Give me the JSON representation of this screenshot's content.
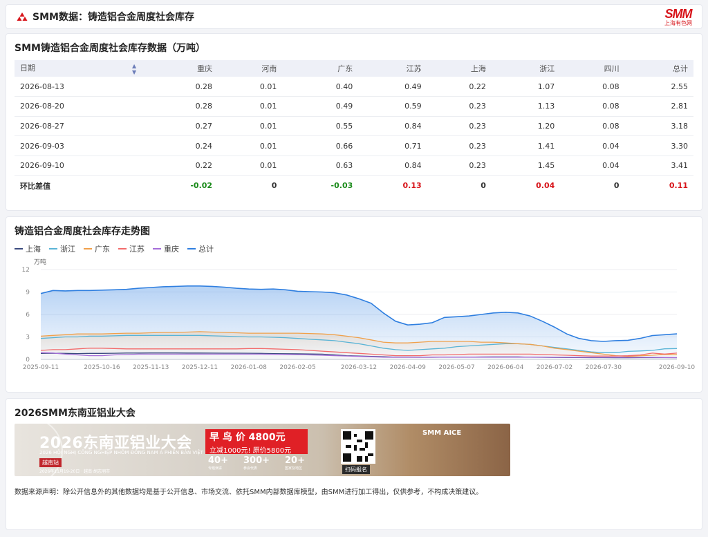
{
  "header": {
    "title": "SMM数据：铸造铝合金周度社会库存",
    "brand_main": "SMM",
    "brand_sub": "上海有色网"
  },
  "table": {
    "title": "SMM铸造铝合金周度社会库存数据（万吨）",
    "columns": [
      "日期",
      "重庆",
      "河南",
      "广东",
      "江苏",
      "上海",
      "浙江",
      "四川",
      "总计"
    ],
    "rows": [
      [
        "2026-08-13",
        "0.28",
        "0.01",
        "0.40",
        "0.49",
        "0.22",
        "1.07",
        "0.08",
        "2.55"
      ],
      [
        "2026-08-20",
        "0.28",
        "0.01",
        "0.49",
        "0.59",
        "0.23",
        "1.13",
        "0.08",
        "2.81"
      ],
      [
        "2026-08-27",
        "0.27",
        "0.01",
        "0.55",
        "0.84",
        "0.23",
        "1.20",
        "0.08",
        "3.18"
      ],
      [
        "2026-09-03",
        "0.24",
        "0.01",
        "0.66",
        "0.71",
        "0.23",
        "1.41",
        "0.04",
        "3.30"
      ],
      [
        "2026-09-10",
        "0.22",
        "0.01",
        "0.63",
        "0.84",
        "0.23",
        "1.45",
        "0.04",
        "3.41"
      ]
    ],
    "diff_row": {
      "label": "环比差值",
      "values": [
        "-0.02",
        "0",
        "-0.03",
        "0.13",
        "0",
        "0.04",
        "0",
        "0.11"
      ],
      "tones": [
        "down",
        "neutral",
        "down",
        "up",
        "neutral",
        "up",
        "neutral",
        "up"
      ]
    },
    "colors": {
      "up": "#d7141a",
      "down": "#1a8a1a"
    }
  },
  "chart": {
    "title": "铸造铝合金周度社会库存走势图",
    "unit": "万吨"
  },
  "chart_data": {
    "type": "line",
    "ylabel": "万吨",
    "ylim": [
      0,
      12
    ],
    "yticks": [
      0,
      3,
      6,
      9,
      12
    ],
    "grid": true,
    "legend_position": "top-left",
    "x_tick_labels": [
      "2025-09-11",
      "2025-10-16",
      "2025-11-13",
      "2025-12-11",
      "2026-01-08",
      "2026-02-05",
      "2026-03-12",
      "2026-04-09",
      "2026-05-07",
      "2026-06-04",
      "2026-07-02",
      "2026-07-30",
      "2026-09-10"
    ],
    "x": [
      "2025-09-11",
      "2025-09-18",
      "2025-09-25",
      "2025-10-02",
      "2025-10-09",
      "2025-10-16",
      "2025-10-23",
      "2025-10-30",
      "2025-11-06",
      "2025-11-13",
      "2025-11-20",
      "2025-11-27",
      "2025-12-04",
      "2025-12-11",
      "2025-12-18",
      "2025-12-25",
      "2026-01-01",
      "2026-01-08",
      "2026-01-15",
      "2026-01-22",
      "2026-01-29",
      "2026-02-05",
      "2026-02-12",
      "2026-02-19",
      "2026-02-26",
      "2026-03-05",
      "2026-03-12",
      "2026-03-19",
      "2026-03-26",
      "2026-04-02",
      "2026-04-09",
      "2026-04-16",
      "2026-04-23",
      "2026-04-30",
      "2026-05-07",
      "2026-05-14",
      "2026-05-21",
      "2026-05-28",
      "2026-06-04",
      "2026-06-11",
      "2026-06-18",
      "2026-06-25",
      "2026-07-02",
      "2026-07-09",
      "2026-07-16",
      "2026-07-23",
      "2026-07-30",
      "2026-08-06",
      "2026-08-13",
      "2026-08-20",
      "2026-08-27",
      "2026-09-03",
      "2026-09-10"
    ],
    "series": [
      {
        "name": "上海",
        "color": "#3a4a7e",
        "values": [
          0.8,
          0.82,
          0.8,
          0.78,
          0.8,
          0.8,
          0.82,
          0.85,
          0.85,
          0.86,
          0.86,
          0.86,
          0.85,
          0.85,
          0.84,
          0.83,
          0.83,
          0.82,
          0.8,
          0.78,
          0.76,
          0.75,
          0.72,
          0.7,
          0.6,
          0.5,
          0.45,
          0.4,
          0.35,
          0.3,
          0.3,
          0.28,
          0.28,
          0.3,
          0.3,
          0.3,
          0.32,
          0.33,
          0.33,
          0.33,
          0.3,
          0.28,
          0.26,
          0.25,
          0.24,
          0.23,
          0.23,
          0.22,
          0.22,
          0.23,
          0.23,
          0.23,
          0.23
        ]
      },
      {
        "name": "浙江",
        "color": "#5ab4d6",
        "values": [
          2.8,
          2.9,
          3.0,
          3.0,
          3.1,
          3.1,
          3.15,
          3.2,
          3.2,
          3.2,
          3.2,
          3.2,
          3.2,
          3.2,
          3.15,
          3.1,
          3.05,
          3.0,
          3.0,
          2.95,
          2.9,
          2.8,
          2.7,
          2.6,
          2.5,
          2.3,
          2.1,
          1.8,
          1.5,
          1.3,
          1.2,
          1.3,
          1.4,
          1.5,
          1.7,
          1.8,
          1.9,
          2.0,
          2.1,
          2.1,
          2.0,
          1.8,
          1.6,
          1.4,
          1.2,
          1.0,
          0.9,
          0.9,
          1.07,
          1.13,
          1.2,
          1.41,
          1.45
        ]
      },
      {
        "name": "广东",
        "color": "#f0a04a",
        "values": [
          3.1,
          3.2,
          3.3,
          3.4,
          3.4,
          3.4,
          3.45,
          3.5,
          3.5,
          3.55,
          3.6,
          3.6,
          3.65,
          3.7,
          3.65,
          3.6,
          3.55,
          3.5,
          3.5,
          3.5,
          3.5,
          3.5,
          3.45,
          3.4,
          3.3,
          3.1,
          2.9,
          2.6,
          2.3,
          2.2,
          2.2,
          2.3,
          2.4,
          2.4,
          2.4,
          2.4,
          2.3,
          2.3,
          2.2,
          2.1,
          2.0,
          1.8,
          1.5,
          1.3,
          1.1,
          0.9,
          0.7,
          0.5,
          0.4,
          0.49,
          0.55,
          0.66,
          0.63
        ]
      },
      {
        "name": "江苏",
        "color": "#f26b6b",
        "values": [
          1.2,
          1.3,
          1.3,
          1.4,
          1.5,
          1.5,
          1.45,
          1.4,
          1.4,
          1.4,
          1.4,
          1.4,
          1.4,
          1.4,
          1.4,
          1.4,
          1.4,
          1.45,
          1.45,
          1.4,
          1.35,
          1.3,
          1.2,
          1.1,
          1.0,
          0.9,
          0.8,
          0.7,
          0.6,
          0.5,
          0.5,
          0.5,
          0.6,
          0.6,
          0.65,
          0.7,
          0.7,
          0.7,
          0.7,
          0.7,
          0.7,
          0.65,
          0.6,
          0.55,
          0.5,
          0.45,
          0.45,
          0.45,
          0.49,
          0.59,
          0.84,
          0.71,
          0.84
        ]
      },
      {
        "name": "重庆",
        "color": "#a56cd9",
        "values": [
          0.9,
          0.85,
          0.7,
          0.6,
          0.5,
          0.5,
          0.6,
          0.65,
          0.7,
          0.7,
          0.7,
          0.7,
          0.7,
          0.7,
          0.7,
          0.7,
          0.7,
          0.7,
          0.7,
          0.68,
          0.66,
          0.64,
          0.6,
          0.55,
          0.5,
          0.45,
          0.4,
          0.35,
          0.3,
          0.28,
          0.28,
          0.28,
          0.3,
          0.3,
          0.3,
          0.3,
          0.3,
          0.3,
          0.3,
          0.3,
          0.3,
          0.3,
          0.28,
          0.28,
          0.28,
          0.28,
          0.28,
          0.28,
          0.28,
          0.28,
          0.27,
          0.24,
          0.22
        ]
      },
      {
        "name": "总计",
        "color": "#2f7fe0",
        "values": [
          8.8,
          9.2,
          9.15,
          9.2,
          9.2,
          9.25,
          9.3,
          9.35,
          9.5,
          9.6,
          9.7,
          9.75,
          9.8,
          9.8,
          9.75,
          9.65,
          9.5,
          9.4,
          9.35,
          9.4,
          9.3,
          9.1,
          9.05,
          9.0,
          8.9,
          8.6,
          8.1,
          7.5,
          6.2,
          5.1,
          4.6,
          4.7,
          4.9,
          5.6,
          5.7,
          5.8,
          6.0,
          6.2,
          6.3,
          6.2,
          5.8,
          5.1,
          4.3,
          3.4,
          2.8,
          2.5,
          2.4,
          2.5,
          2.55,
          2.81,
          3.18,
          3.3,
          3.41
        ]
      }
    ]
  },
  "ad": {
    "title": "2026SMM东南亚铝业大会",
    "banner_title": "2026东南亚铝业大会",
    "banner_subtitle": "2026 HỘI NGHỊ CÔNG NGHIỆP NHÔM ĐÔNG NAM Á PHIÊN BẢN VIỆT NAM",
    "banner_place": "越南站",
    "banner_date": "2026年11月19-20日 · 越南·胡志明市",
    "promo_line1": "早 鸟 价 4800元",
    "promo_line2": "立减1000元! 原价5800元",
    "stats": [
      {
        "num": "40+",
        "label": "专题演讲"
      },
      {
        "num": "300+",
        "label": "参会代表"
      },
      {
        "num": "20+",
        "label": "国家及地区"
      }
    ],
    "qr_label": "扫码报名",
    "aice_label": "SMM AICE"
  },
  "disclaimer": "数据来源声明：除公开信息外的其他数据均是基于公开信息、市场交流、依托SMM内部数据库模型，由SMM进行加工得出，仅供参考，不构成决策建议。"
}
